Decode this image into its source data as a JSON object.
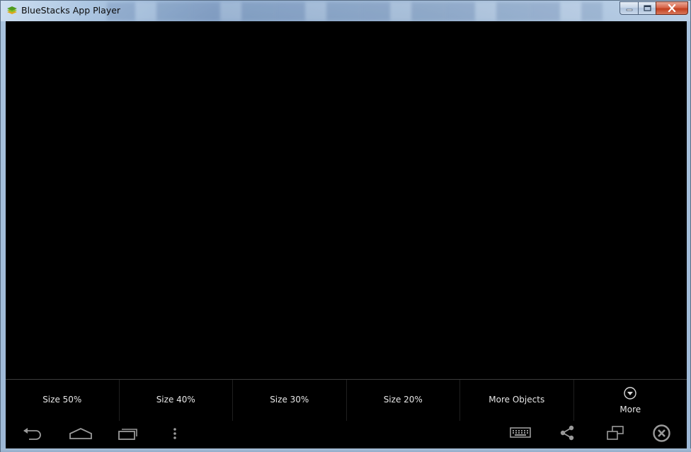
{
  "window": {
    "title": "BlueStacks App Player",
    "controls": {
      "minimize_icon": "minimize-icon",
      "maximize_icon": "maximize-icon",
      "close_icon": "close-icon"
    }
  },
  "options_bar": {
    "items": [
      {
        "label": "Size 50%"
      },
      {
        "label": "Size 40%"
      },
      {
        "label": "Size 30%"
      },
      {
        "label": "Size 20%"
      },
      {
        "label": "More Objects"
      },
      {
        "label": "More",
        "icon": "chevron-down-circle-icon"
      }
    ]
  },
  "navbar": {
    "left": [
      "back-icon",
      "home-icon",
      "recent-apps-icon",
      "menu-dots-icon"
    ],
    "right": [
      "keyboard-icon",
      "share-icon",
      "window-switch-icon",
      "close-circle-icon"
    ]
  },
  "colors": {
    "screen_bg": "#000000",
    "option_text": "#e6e6e6",
    "nav_icon": "#9a9a9a"
  }
}
